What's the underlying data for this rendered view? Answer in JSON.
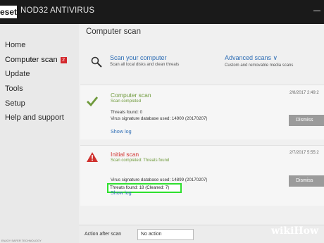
{
  "titlebar": {
    "logo": "eset",
    "title": "NOD32 ANTIVIRUS"
  },
  "sidebar": {
    "items": [
      {
        "label": "Home"
      },
      {
        "label": "Computer scan",
        "badge": "2",
        "active": true
      },
      {
        "label": "Update"
      },
      {
        "label": "Tools"
      },
      {
        "label": "Setup"
      },
      {
        "label": "Help and support"
      }
    ],
    "version": "ENJOY SAFER TECHNOLOGY"
  },
  "main": {
    "title": "Computer scan",
    "scan_computer": {
      "title": "Scan your computer",
      "desc": "Scan all local disks and clean threats",
      "icon": "magnifier-icon"
    },
    "advanced_scans": {
      "title": "Advanced scans ∨",
      "desc": "Custom and removable media scans"
    },
    "cards": [
      {
        "icon": "check-icon",
        "title": "Computer scan",
        "title_color": "#6f9a3c",
        "status": "Scan completed",
        "line1": "Threats found: 0",
        "line2": "Virus signature database used: 14900 (20170207)",
        "date": "2/8/2017 2:49:2",
        "dismiss": "Dismiss",
        "show_log": "Show log"
      },
      {
        "icon": "warning-icon",
        "title": "Initial scan",
        "title_color": "#d0322f",
        "status": "Scan completed: Threats found",
        "line1": "Threats found: 18 (Cleaned: 7)",
        "line2": "Virus signature database used: 14899 (20170207)",
        "date": "2/7/2017 5:55:2",
        "dismiss": "Dismiss",
        "show_log": "Show log"
      }
    ],
    "after_scan": {
      "label": "Action after scan",
      "value": "No action"
    }
  },
  "watermark": {
    "wiki": "wiki",
    "how": "How"
  }
}
